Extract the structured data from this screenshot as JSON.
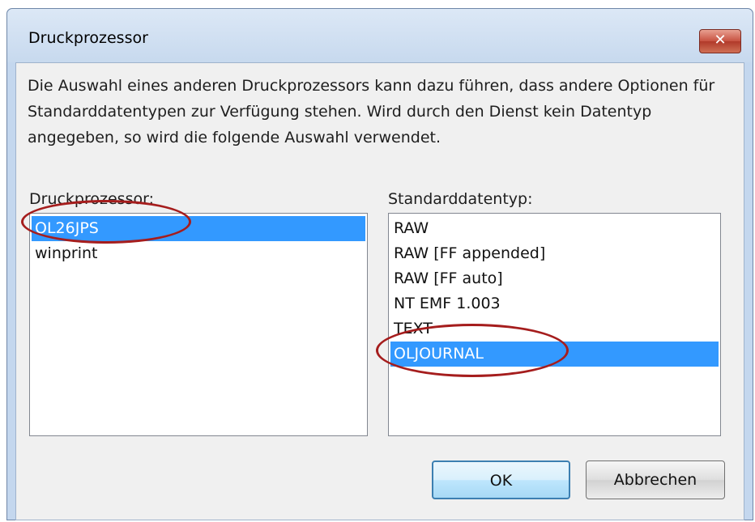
{
  "window": {
    "title": "Druckprozessor",
    "close_glyph": "✕"
  },
  "description": "Die Auswahl eines anderen Druckprozessors kann dazu führen, dass andere Optionen für Standarddatentypen zur Verfügung stehen. Wird durch den Dienst kein Datentyp angegeben, so wird die folgende Auswahl verwendet.",
  "processor_list": {
    "label": "Druckprozessor:",
    "items": [
      "OL26JPS",
      "winprint"
    ],
    "selected": "OL26JPS"
  },
  "datatype_list": {
    "label": "Standarddatentyp:",
    "items": [
      "RAW",
      "RAW [FF appended]",
      "RAW [FF auto]",
      "NT EMF 1.003",
      "TEXT",
      "OLJOURNAL"
    ],
    "selected": "OLJOURNAL"
  },
  "buttons": {
    "ok": "OK",
    "cancel": "Abbrechen"
  },
  "colors": {
    "selection": "#3399ff",
    "annotation": "#a51d1d"
  }
}
